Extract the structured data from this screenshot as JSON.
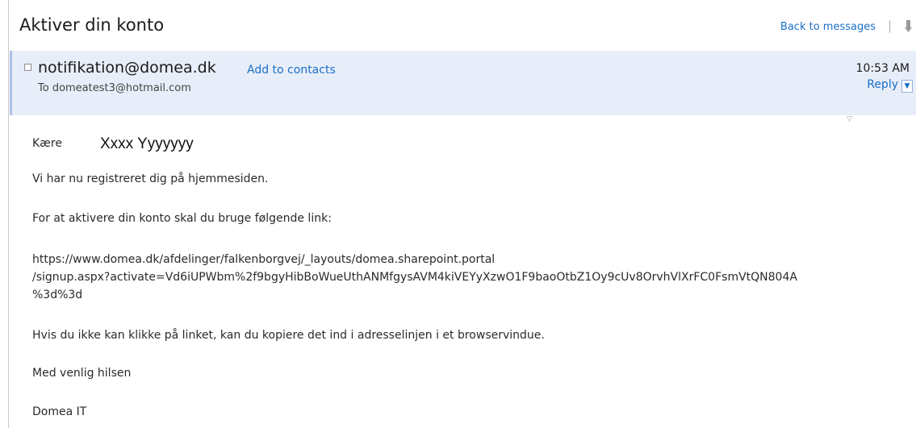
{
  "email": {
    "subject": "Aktiver din konto",
    "back_label": "Back to messages",
    "separator": "|",
    "sender": "notifikation@domea.dk",
    "add_contacts_label": "Add to contacts",
    "to_line": "To domeatest3@hotmail.com",
    "time": "10:53 AM",
    "reply_label": "Reply",
    "greeting": "Kære",
    "recipient_name": "Xxxx Yyyyyyy",
    "para1": "Vi har nu registreret dig på hjemmesiden.",
    "para2": "For at aktivere din konto skal du bruge følgende link:",
    "link_line1": "https://www.domea.dk/afdelinger/falkenborgvej/_layouts/domea.sharepoint.portal",
    "link_line2": "/signup.aspx?activate=Vd6iUPWbm%2f9bgyHibBoWueUthANMfgysAVM4kiVEYyXzwO1F9baoOtbZ1Oy9cUv8OrvhVlXrFC0FsmVtQN804A",
    "link_line3": "%3d%3d",
    "para3": "Hvis du ikke kan klikke på linket, kan du kopiere det ind i adresselinjen i et browservindue.",
    "signoff": "Med venlig hilsen",
    "signature": "Domea IT"
  },
  "icons": {
    "checkbox": "checkbox-icon",
    "dropdown": "chevron-down-icon",
    "flag": "flag-icon",
    "expand": "expand-triangle-icon"
  },
  "colors": {
    "link": "#1a6fc7",
    "header_bg": "#e8eef9",
    "header_border": "#a9bfe8"
  }
}
